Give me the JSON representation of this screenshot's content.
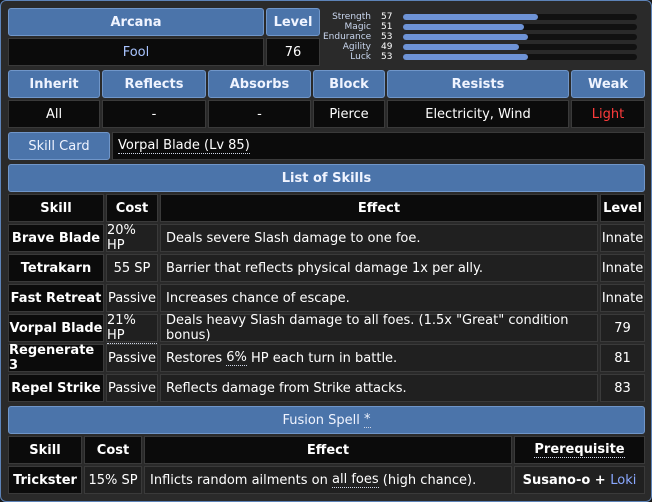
{
  "header": {
    "arcana_label": "Arcana",
    "arcana_value": "Fool",
    "level_label": "Level",
    "level_value": "76"
  },
  "stats": [
    {
      "label": "Strength",
      "value": 57
    },
    {
      "label": "Magic",
      "value": 51
    },
    {
      "label": "Endurance",
      "value": 53
    },
    {
      "label": "Agility",
      "value": 49
    },
    {
      "label": "Luck",
      "value": 53
    }
  ],
  "stat_max": 99,
  "affinities": {
    "headers": [
      "Inherit",
      "Reflects",
      "Absorbs",
      "Block",
      "Resists",
      "Weak"
    ],
    "values": [
      "All",
      "-",
      "-",
      "Pierce",
      "Electricity, Wind",
      "Light"
    ]
  },
  "skill_card": {
    "label": "Skill Card",
    "value": "Vorpal Blade (Lv 85)"
  },
  "skills": {
    "title": "List of Skills",
    "columns": [
      "Skill",
      "Cost",
      "Effect",
      "Level"
    ],
    "rows": [
      {
        "skill": "Brave Blade",
        "cost": "20% HP",
        "effect": "Deals severe Slash damage to one foe.",
        "level": "Innate"
      },
      {
        "skill": "Tetrakarn",
        "cost": "55 SP",
        "effect": "Barrier that reflects physical damage 1x per ally.",
        "level": "Innate"
      },
      {
        "skill": "Fast Retreat",
        "cost": "Passive",
        "effect": "Increases chance of escape.",
        "level": "Innate"
      },
      {
        "skill": "Vorpal Blade",
        "cost": "21% HP",
        "effect": "Deals heavy Slash damage to all foes. (1.5x \"Great\" condition bonus)",
        "level": "79"
      },
      {
        "skill": "Regenerate 3",
        "cost": "Passive",
        "effect_pre": "Restores ",
        "effect_mark": "6%",
        "effect_post": " HP each turn in battle.",
        "level": "81"
      },
      {
        "skill": "Repel Strike",
        "cost": "Passive",
        "effect": "Reflects damage from Strike attacks.",
        "level": "83"
      }
    ]
  },
  "fusion": {
    "title": "Fusion Spell",
    "title_mark": "*",
    "columns": [
      "Skill",
      "Cost",
      "Effect",
      "Prerequisite"
    ],
    "row": {
      "skill": "Trickster",
      "cost": "15% SP",
      "effect_pre": "Inflicts random ailments on ",
      "effect_mark": "all foes",
      "effect_post": " (high chance).",
      "prereq_a": "Susano-o",
      "prereq_plus": " + ",
      "prereq_b": "Loki"
    }
  },
  "colors": {
    "header_bg": "#4b74aa",
    "weak_text": "#ff3b3b",
    "link_text": "#8aa8ff",
    "stat_bar": "#6e93d6"
  }
}
